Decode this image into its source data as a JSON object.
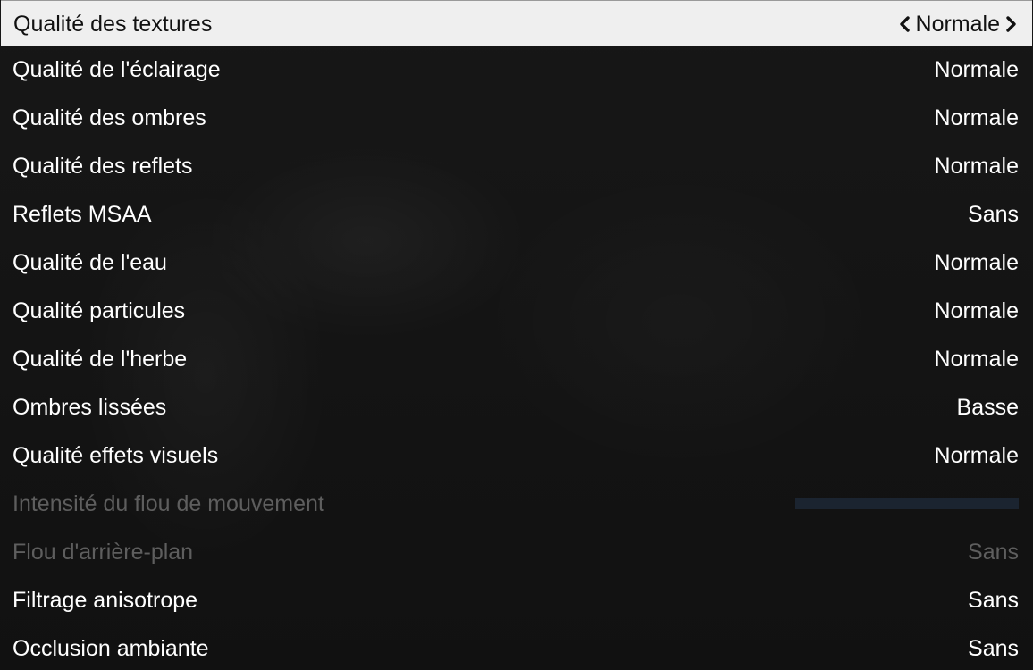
{
  "settings": [
    {
      "label": "Qualité des textures",
      "value": "Normale",
      "state": "selected"
    },
    {
      "label": "Qualité de l'éclairage",
      "value": "Normale",
      "state": "normal"
    },
    {
      "label": "Qualité des ombres",
      "value": "Normale",
      "state": "normal"
    },
    {
      "label": "Qualité des reflets",
      "value": "Normale",
      "state": "normal"
    },
    {
      "label": "Reflets MSAA",
      "value": "Sans",
      "state": "normal"
    },
    {
      "label": "Qualité de l'eau",
      "value": "Normale",
      "state": "normal"
    },
    {
      "label": "Qualité particules",
      "value": "Normale",
      "state": "normal"
    },
    {
      "label": "Qualité de l'herbe",
      "value": "Normale",
      "state": "normal"
    },
    {
      "label": "Ombres lissées",
      "value": "Basse",
      "state": "normal"
    },
    {
      "label": "Qualité effets visuels",
      "value": "Normale",
      "state": "normal"
    },
    {
      "label": "Intensité du flou de mouvement",
      "value": null,
      "state": "disabled",
      "control": "slider",
      "slider_level": 0
    },
    {
      "label": "Flou d'arrière-plan",
      "value": "Sans",
      "state": "disabled"
    },
    {
      "label": "Filtrage anisotrope",
      "value": "Sans",
      "state": "normal"
    },
    {
      "label": "Occlusion ambiante",
      "value": "Sans",
      "state": "normal"
    }
  ],
  "icons": {
    "prev": "chevron-left-icon",
    "next": "chevron-right-icon"
  },
  "colors": {
    "selected_bg": "#efefef",
    "selected_text": "#111111",
    "text": "#ffffff",
    "disabled_text": "#5e5e5e",
    "slider_track": "#1b2430"
  }
}
